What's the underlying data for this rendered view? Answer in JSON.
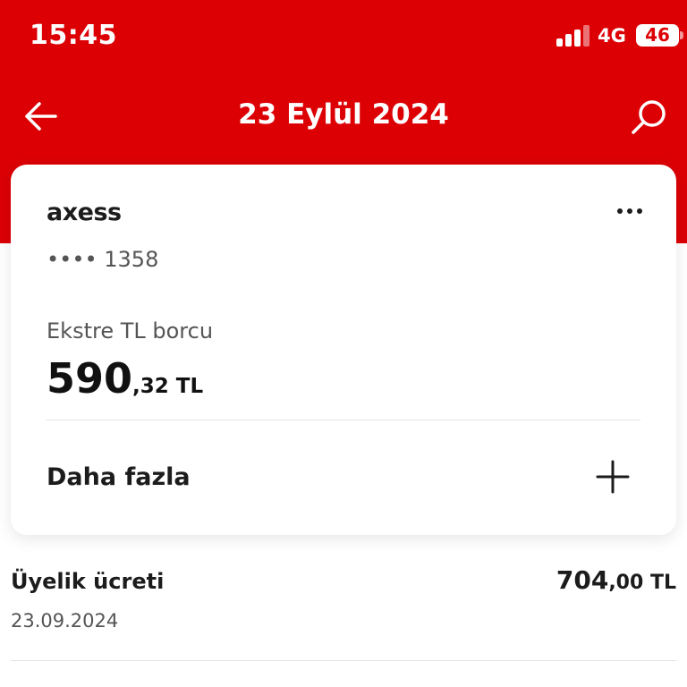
{
  "status_bar": {
    "time": "15:45",
    "network": "4G",
    "battery": "46"
  },
  "header": {
    "title": "23 Eylül 2024",
    "back_icon": "arrow-left-icon",
    "search_icon": "search-icon"
  },
  "card": {
    "brand": "axess",
    "number": "•••• 1358",
    "debt_label": "Ekstre TL borcu",
    "debt_whole": "590",
    "debt_fraction": ",32 TL",
    "more_label": "Daha fazla",
    "more_icon": "plus-icon",
    "menu_icon": "more-horizontal-icon"
  },
  "transactions": [
    {
      "title": "Üyelik ücreti",
      "date": "23.09.2024",
      "amount_whole": "704",
      "amount_fraction": ",00 TL"
    }
  ],
  "colors": {
    "brand_red": "#dc0005",
    "text_primary": "#1c1c1c",
    "text_secondary": "#555555"
  }
}
